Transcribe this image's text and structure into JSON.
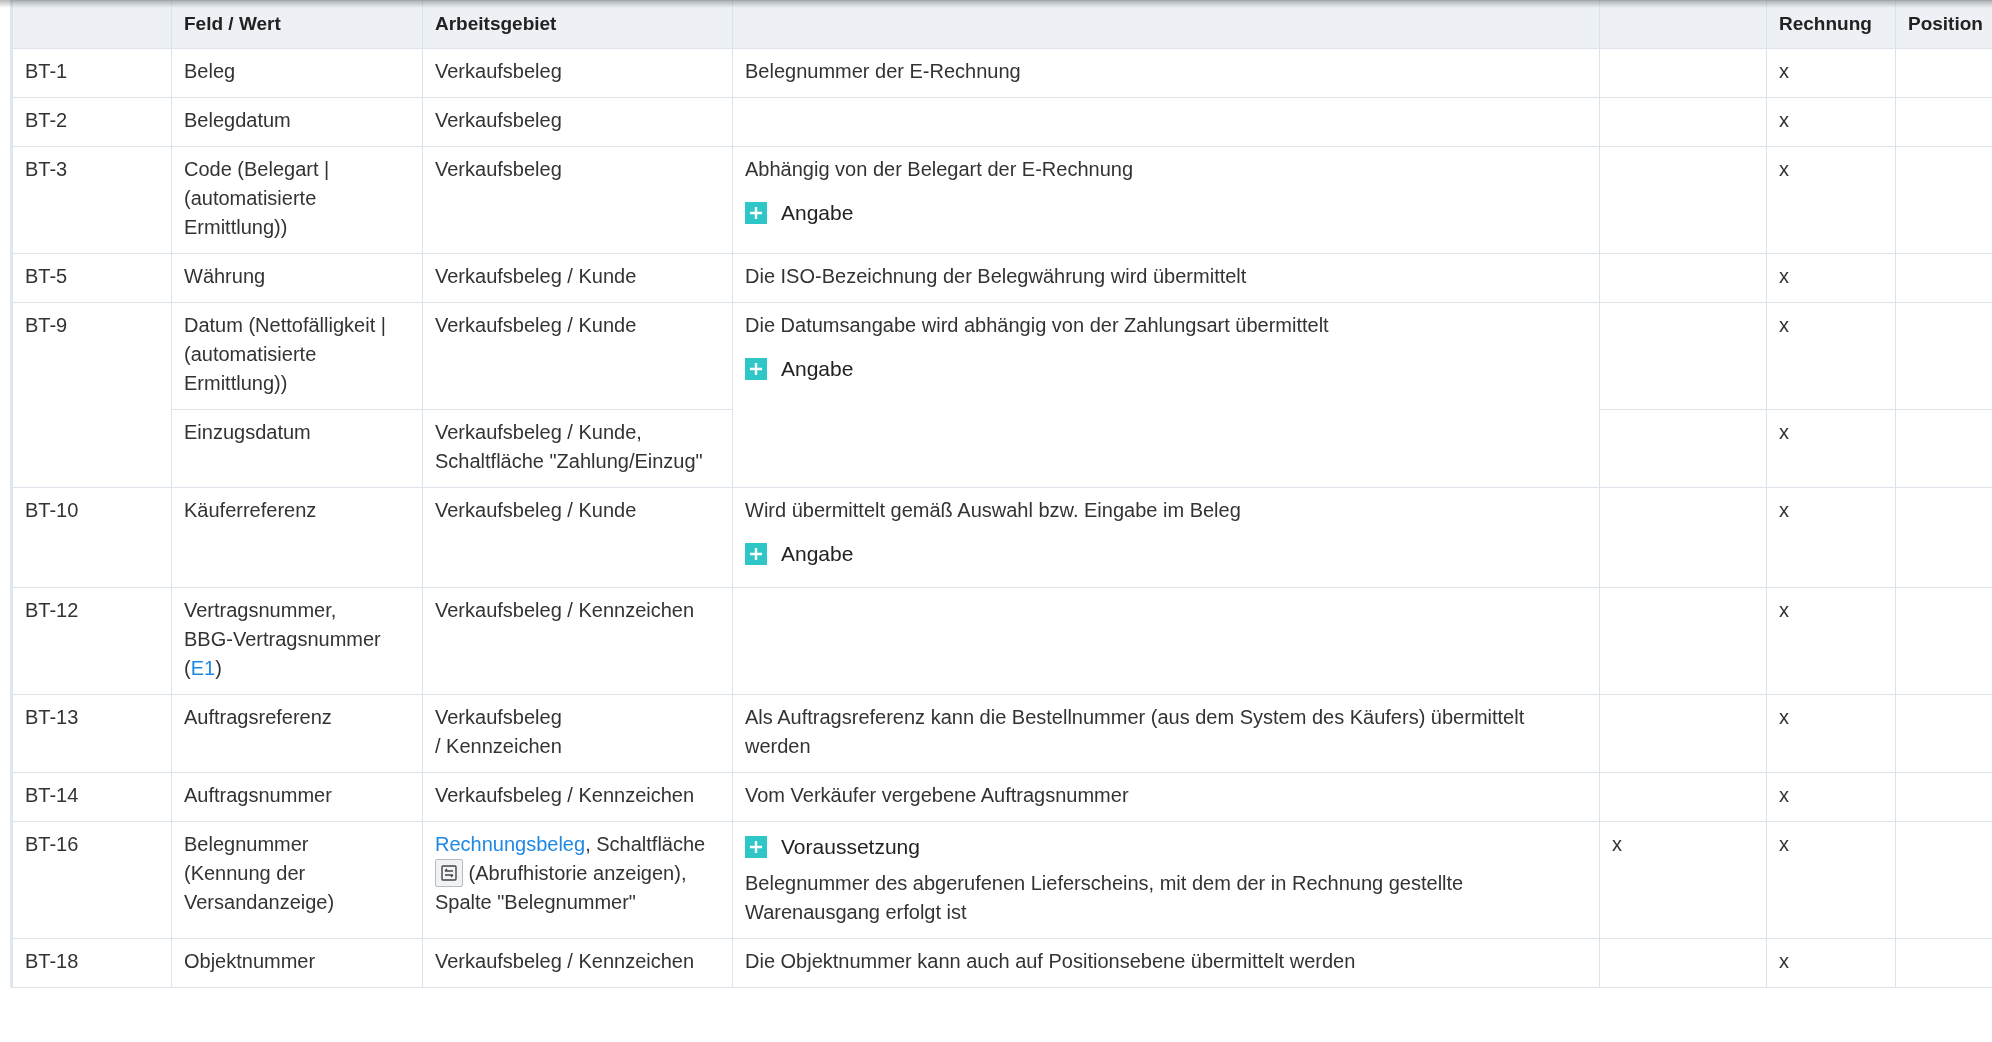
{
  "table": {
    "header": {
      "feld": "Feld / Wert",
      "arbeitsgebiet": "Arbeitsgebiet",
      "rechnung": "Rechnung",
      "position": "Position"
    },
    "groups": [
      {
        "id": "BT-1",
        "entries": [
          {
            "field": "Beleg",
            "area": "Verkaufsbeleg",
            "rechnung": "x"
          }
        ],
        "description": [
          {
            "kind": "text",
            "text": "Belegnummer der E-Rechnung"
          }
        ]
      },
      {
        "id": "BT-2",
        "entries": [
          {
            "field": "Belegdatum",
            "area": "Verkaufsbeleg",
            "rechnung": "x"
          }
        ]
      },
      {
        "id": "BT-3",
        "entries": [
          {
            "field": "Code (Belegart |\n(automatisierte\nErmittlung))",
            "area": "Verkaufsbeleg",
            "rechnung": "x"
          }
        ],
        "description": [
          {
            "kind": "text",
            "text": "Abhängig von der Belegart der E-Rechnung"
          },
          {
            "kind": "expander",
            "label": "Angabe",
            "expanded": false
          }
        ]
      },
      {
        "id": "BT-5",
        "entries": [
          {
            "field": "Währung",
            "area": "Verkaufsbeleg / Kunde",
            "rechnung": "x"
          }
        ],
        "description": [
          {
            "kind": "text",
            "text": "Die ISO-Bezeichnung der Belegwährung wird übermittelt"
          }
        ]
      },
      {
        "id": "BT-9",
        "entries": [
          {
            "field": "Datum (Nettofälligkeit |\n(automatisierte\nErmittlung))",
            "area": "Verkaufsbeleg / Kunde",
            "rechnung": "x"
          },
          {
            "field": "Einzugsdatum",
            "area": "Verkaufsbeleg / Kunde,\nSchaltfläche \"Zahlung/Einzug\"",
            "rechnung": "x"
          }
        ],
        "description": [
          {
            "kind": "text",
            "text": "Die Datumsangabe wird abhängig von der Zahlungsart übermittelt"
          },
          {
            "kind": "expander",
            "label": "Angabe",
            "expanded": false
          }
        ]
      },
      {
        "id": "BT-10",
        "entries": [
          {
            "field": "Käuferreferenz",
            "area": "Verkaufsbeleg / Kunde",
            "rechnung": "x"
          }
        ],
        "description": [
          {
            "kind": "text",
            "text": "Wird übermittelt gemäß Auswahl bzw. Eingabe im Beleg"
          },
          {
            "kind": "expander",
            "label": "Angabe",
            "expanded": false
          }
        ]
      },
      {
        "id": "BT-12",
        "entries": [
          {
            "field": [
              {
                "kind": "text",
                "text": "Vertragsnummer,\nBBG-Vertragsnummer\n("
              },
              {
                "kind": "link",
                "text": "E1"
              },
              {
                "kind": "text",
                "text": ")"
              }
            ],
            "area": "Verkaufsbeleg / Kennzeichen",
            "rechnung": "x"
          }
        ]
      },
      {
        "id": "BT-13",
        "entries": [
          {
            "field": "Auftragsreferenz",
            "area": "Verkaufsbeleg\n/ Kennzeichen",
            "rechnung": "x"
          }
        ],
        "description": [
          {
            "kind": "text",
            "text": "Als Auftragsreferenz kann die Bestellnummer (aus dem System des Käufers) übermittelt werden"
          }
        ]
      },
      {
        "id": "BT-14",
        "entries": [
          {
            "field": "Auftragsnummer",
            "area": "Verkaufsbeleg / Kennzeichen",
            "rechnung": "x"
          }
        ],
        "description": [
          {
            "kind": "text",
            "text": "Vom Verkäufer vergebene Auftragsnummer"
          }
        ]
      },
      {
        "id": "BT-16",
        "entries": [
          {
            "field": "Belegnummer\n(Kennung der\nVersandanzeige)",
            "area": [
              {
                "kind": "link",
                "text": "Rechnungsbeleg"
              },
              {
                "kind": "text",
                "text": ", Schaltfläche\n"
              },
              {
                "kind": "icon"
              },
              {
                "kind": "text",
                "text": " (Abrufhistorie anzeigen),\nSpalte \"Belegnummer\""
              }
            ],
            "column_5": "x",
            "rechnung": "x"
          }
        ],
        "description": [
          {
            "kind": "expander",
            "label": "Voraussetzung",
            "expanded": false
          },
          {
            "kind": "text",
            "text": "Belegnummer des abgerufenen Lieferscheins, mit dem der in Rechnung gestellte Warenausgang erfolgt ist"
          }
        ]
      },
      {
        "id": "BT-18",
        "entries": [
          {
            "field": "Objektnummer",
            "area": "Verkaufsbeleg / Kennzeichen",
            "rechnung": "x"
          }
        ],
        "description": [
          {
            "kind": "text",
            "text": "Die Objektnummer kann auch auf Positionsebene übermittelt werden"
          }
        ]
      }
    ]
  }
}
